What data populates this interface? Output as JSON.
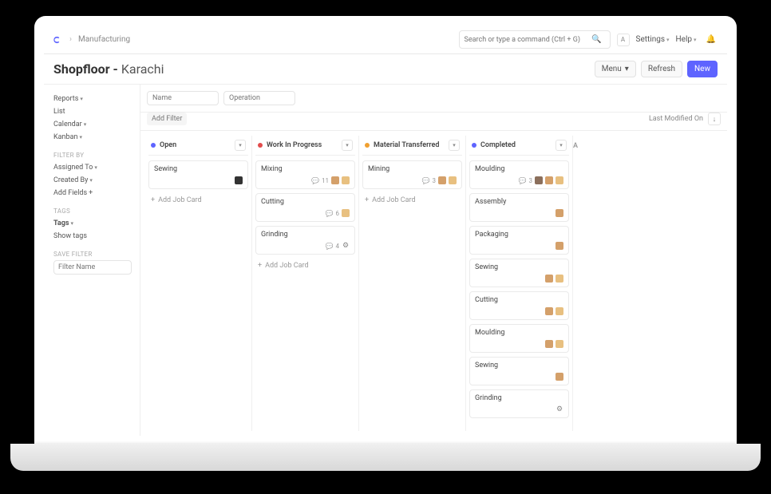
{
  "breadcrumb": "Manufacturing",
  "search": {
    "placeholder": "Search or type a command (Ctrl + G)"
  },
  "user_initial": "A",
  "top_links": {
    "settings": "Settings",
    "help": "Help"
  },
  "page_title": {
    "main": "Shopfloor -",
    "sub": "Karachi"
  },
  "header_buttons": {
    "menu": "Menu",
    "refresh": "Refresh",
    "new": "New"
  },
  "sidebar": {
    "views": [
      {
        "label": "Reports",
        "caret": true
      },
      {
        "label": "List",
        "caret": false
      },
      {
        "label": "Calendar",
        "caret": true
      },
      {
        "label": "Kanban",
        "caret": true
      }
    ],
    "filter_by_label": "FILTER BY",
    "filter_items": [
      {
        "label": "Assigned To",
        "caret": true
      },
      {
        "label": "Created By",
        "caret": true
      }
    ],
    "add_fields": "Add Fields",
    "tags_label": "TAGS",
    "tags": "Tags",
    "show_tags": "Show tags",
    "save_filter_label": "SAVE FILTER",
    "filter_name_placeholder": "Filter Name"
  },
  "filters": {
    "name_placeholder": "Name",
    "operation_placeholder": "Operation",
    "add_filter": "Add Filter",
    "last_modified": "Last Modified On"
  },
  "columns": [
    {
      "name": "Open",
      "color": "#5e64ff",
      "cards": [
        {
          "title": "Sewing",
          "avatars": [
            "a4"
          ]
        }
      ],
      "add": "Add Job Card"
    },
    {
      "name": "Work In Progress",
      "color": "#e24c4c",
      "cards": [
        {
          "title": "Mixing",
          "comments": 11,
          "avatars": [
            "a1",
            "a2"
          ]
        },
        {
          "title": "Cutting",
          "comments": 6,
          "avatars": [
            "a2"
          ]
        },
        {
          "title": "Grinding",
          "comments": 4,
          "avatars": [
            "gear"
          ]
        }
      ],
      "add": "Add Job Card"
    },
    {
      "name": "Material Transferred",
      "color": "#f0a030",
      "cards": [
        {
          "title": "Mining",
          "comments": 3,
          "avatars": [
            "a1",
            "a2"
          ]
        }
      ],
      "add": "Add Job Card"
    },
    {
      "name": "Completed",
      "color": "#5e64ff",
      "cards": [
        {
          "title": "Moulding",
          "comments": 3,
          "avatars": [
            "a3",
            "a1",
            "a2"
          ]
        },
        {
          "title": "Assembly",
          "avatars": [
            "a1"
          ]
        },
        {
          "title": "Packaging",
          "avatars": [
            "a1"
          ]
        },
        {
          "title": "Sewing",
          "avatars": [
            "a1",
            "a2"
          ]
        },
        {
          "title": "Cutting",
          "avatars": [
            "a1",
            "a2"
          ]
        },
        {
          "title": "Moulding",
          "avatars": [
            "a1",
            "a2"
          ]
        },
        {
          "title": "Sewing",
          "avatars": [
            "a1"
          ]
        },
        {
          "title": "Grinding",
          "avatars": [
            "gear"
          ]
        }
      ]
    }
  ],
  "next_col_hint": "A"
}
